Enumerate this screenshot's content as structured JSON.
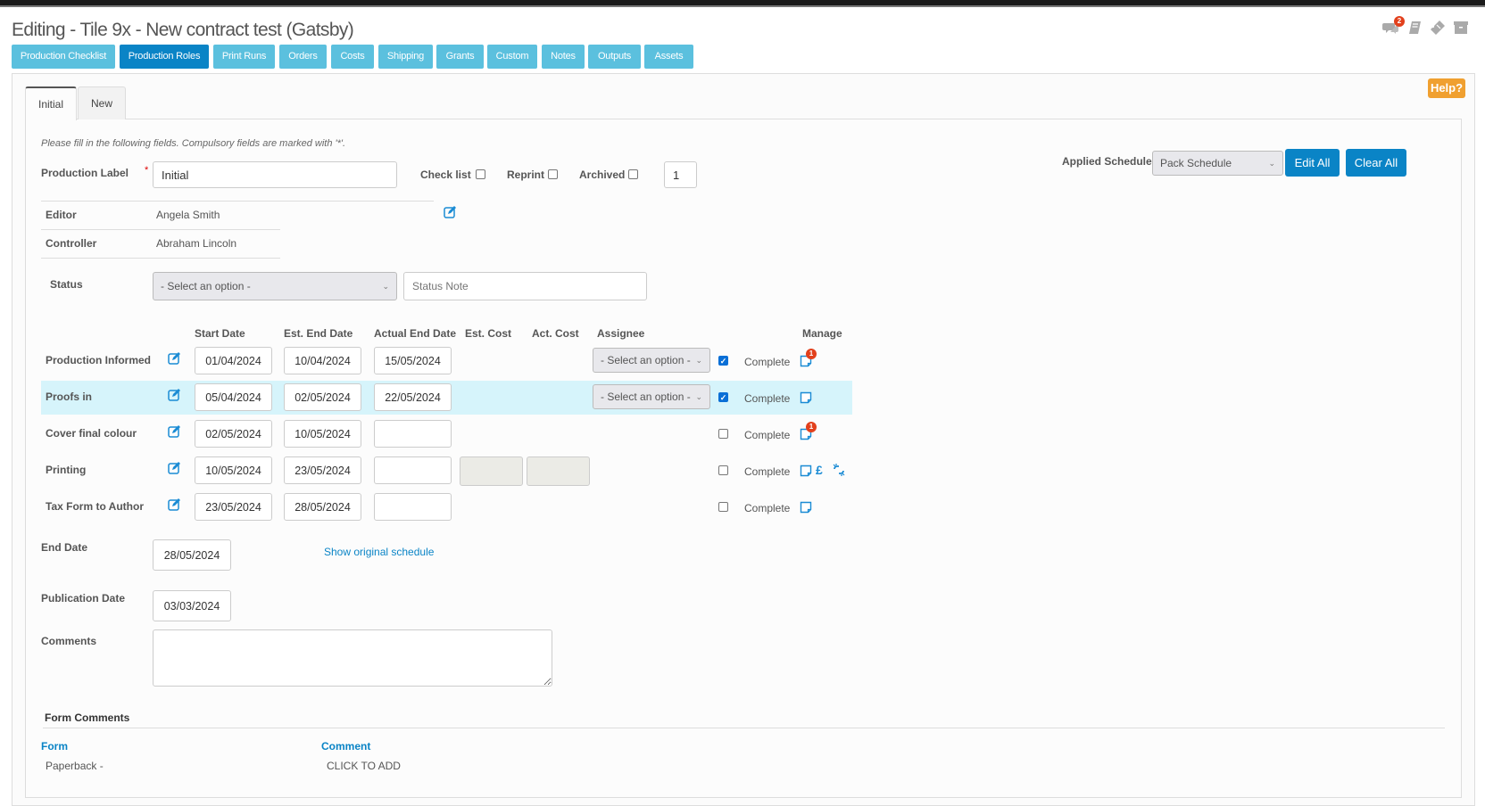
{
  "header": {
    "title": "Editing - Tile 9x - New contract test (Gatsby)",
    "comments_badge": "2",
    "icons": [
      "comments-icon",
      "book-icon",
      "ticket-icon",
      "archive-icon"
    ]
  },
  "nav": {
    "buttons": [
      {
        "label": "Production Checklist",
        "active": false
      },
      {
        "label": "Production Roles",
        "active": true
      },
      {
        "label": "Print Runs",
        "active": false
      },
      {
        "label": "Orders",
        "active": false
      },
      {
        "label": "Costs",
        "active": false
      },
      {
        "label": "Shipping",
        "active": false
      },
      {
        "label": "Grants",
        "active": false
      },
      {
        "label": "Custom",
        "active": false
      },
      {
        "label": "Notes",
        "active": false
      },
      {
        "label": "Outputs",
        "active": false
      },
      {
        "label": "Assets",
        "active": false
      }
    ]
  },
  "help_label": "Help?",
  "tabs": [
    {
      "label": "Initial",
      "active": true
    },
    {
      "label": "New",
      "active": false
    }
  ],
  "form": {
    "note": "Please fill in the following fields. Compulsory fields are marked with '*'.",
    "production_label": {
      "label": "Production Label",
      "required_marker": "*",
      "value": "Initial"
    },
    "check_list": {
      "label": "Check list",
      "checked": false
    },
    "reprint": {
      "label": "Reprint",
      "checked": false
    },
    "archived": {
      "label": "Archived",
      "checked": false
    },
    "number_value": "1",
    "applied_schedule": {
      "label": "Applied Schedule",
      "value": "Pack Schedule"
    },
    "edit_all_label": "Edit All",
    "clear_all_label": "Clear All",
    "editor": {
      "label": "Editor",
      "value": "Angela Smith"
    },
    "controller": {
      "label": "Controller",
      "value": "Abraham Lincoln"
    },
    "status": {
      "label": "Status",
      "value": "- Select an option -",
      "note_placeholder": "Status Note"
    }
  },
  "schedule": {
    "headers": {
      "start": "Start Date",
      "est_end": "Est. End Date",
      "actual_end": "Actual End Date",
      "est_cost": "Est. Cost",
      "act_cost": "Act. Cost",
      "assignee": "Assignee",
      "manage": "Manage"
    },
    "complete_label": "Complete",
    "rows": [
      {
        "name": "Production Informed",
        "start": "01/04/2024",
        "est_end": "10/04/2024",
        "actual_end": "15/05/2024",
        "assignee": "- Select an option -",
        "complete": true,
        "note_badge": "1",
        "highlight": false
      },
      {
        "name": "Proofs in",
        "start": "05/04/2024",
        "est_end": "02/05/2024",
        "actual_end": "22/05/2024",
        "assignee": "- Select an option -",
        "complete": true,
        "note_badge": "",
        "highlight": true
      },
      {
        "name": "Cover final colour",
        "start": "02/05/2024",
        "est_end": "10/05/2024",
        "actual_end": "",
        "complete": false,
        "note_badge": "1",
        "highlight": false
      },
      {
        "name": "Printing",
        "start": "10/05/2024",
        "est_end": "23/05/2024",
        "actual_end": "",
        "est_cost": "",
        "act_cost": "",
        "complete": false,
        "note_badge": "",
        "highlight": false
      },
      {
        "name": "Tax Form to Author",
        "start": "23/05/2024",
        "est_end": "28/05/2024",
        "actual_end": "",
        "complete": false,
        "note_badge": "",
        "highlight": false
      }
    ],
    "pound_symbol": "£"
  },
  "end_date": {
    "label": "End Date",
    "value": "28/05/2024"
  },
  "show_original_label": "Show original schedule",
  "publication_date": {
    "label": "Publication Date",
    "value": "03/03/2024"
  },
  "comments": {
    "label": "Comments",
    "value": ""
  },
  "form_comments": {
    "title": "Form Comments",
    "headers": {
      "form": "Form",
      "comment": "Comment"
    },
    "rows": [
      {
        "form": "Paperback -",
        "comment": "CLICK TO ADD"
      }
    ]
  }
}
